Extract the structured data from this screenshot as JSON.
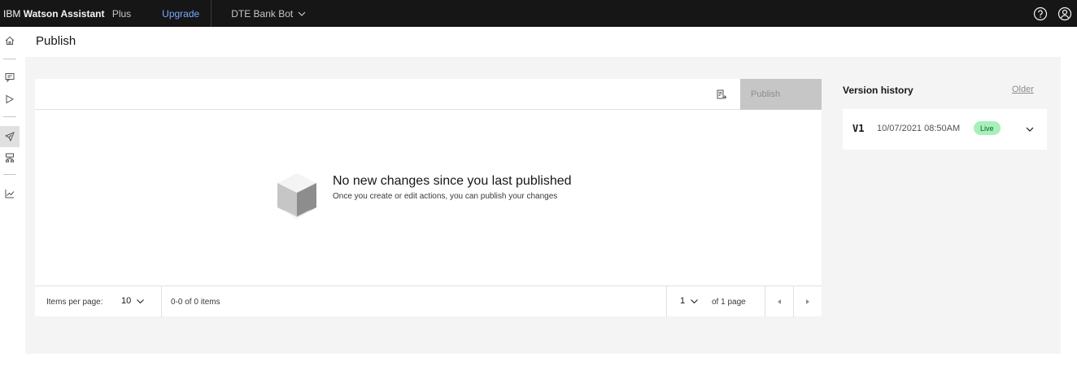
{
  "header": {
    "brand_ibm": "IBM",
    "brand_product": "Watson Assistant",
    "plan": "Plus",
    "upgrade_label": "Upgrade",
    "assistant_name": "DTE Bank Bot",
    "icons": [
      "help-icon",
      "user-avatar-icon"
    ]
  },
  "rail": {
    "items": [
      {
        "icon": "home-icon"
      },
      {
        "icon": "actions-icon"
      },
      {
        "icon": "preview-icon"
      },
      {
        "icon": "publish-icon",
        "active": true
      },
      {
        "icon": "integrations-icon"
      },
      {
        "icon": "analytics-icon"
      }
    ]
  },
  "page": {
    "title": "Publish"
  },
  "table": {
    "publish_label": "Publish",
    "empty_title": "No new changes since you last published",
    "empty_subtitle": "Once you create or edit actions, you can publish your changes",
    "pagination": {
      "items_per_page_label": "Items per page:",
      "items_per_page_value": "10",
      "range_text": "0-0 of 0 items",
      "page_value": "1",
      "of_pages_text": "of 1 page"
    }
  },
  "version_history": {
    "title": "Version history",
    "older_label": "Older",
    "items": [
      {
        "version": "V1",
        "date": "10/07/2021 08:50AM",
        "status": "Live"
      }
    ]
  },
  "colors": {
    "header_bg": "#161616",
    "upgrade_link": "#78a9ff",
    "main_bg": "#f4f4f4",
    "publish_disabled_bg": "#c6c6c6",
    "live_tag_bg": "#a7f0ba",
    "live_tag_text": "#0e6027"
  }
}
